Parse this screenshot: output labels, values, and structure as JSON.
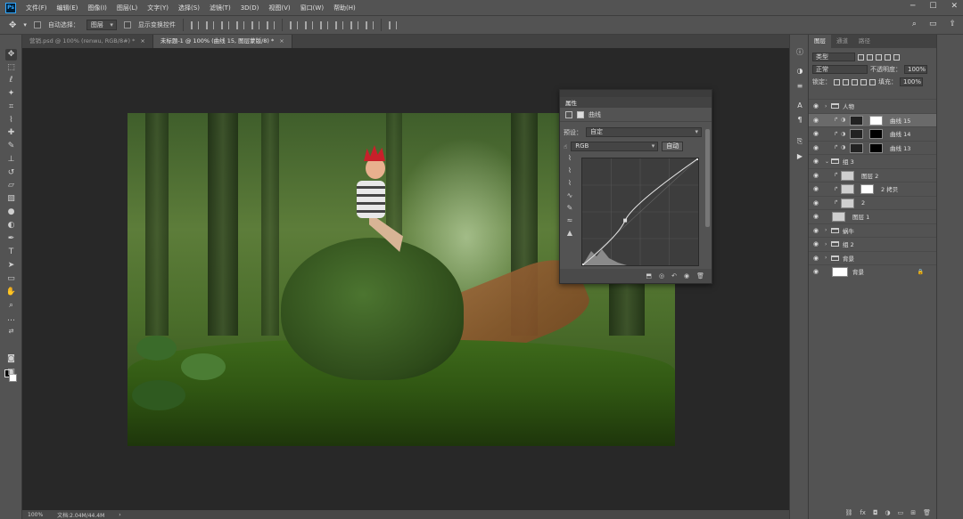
{
  "menu": [
    "文件(F)",
    "编辑(E)",
    "图像(I)",
    "图层(L)",
    "文字(Y)",
    "选择(S)",
    "滤镜(T)",
    "3D(D)",
    "视图(V)",
    "窗口(W)",
    "帮助(H)"
  ],
  "app_logo": "Ps",
  "options": {
    "auto_select_label": "自动选择：",
    "auto_select_value": "图层",
    "show_transform_label": "显示变换控件"
  },
  "tabs": [
    {
      "label": "营销.psd @ 100% (renwu, RGB/8#) *",
      "close": "×"
    },
    {
      "label": "未标题-1 @ 100% (曲线 15, 图层蒙版/8) *",
      "close": "×"
    }
  ],
  "properties": {
    "tab": "属性",
    "header_label": "曲线",
    "preset_label": "预设：",
    "preset_value": "自定",
    "channel_value": "RGB",
    "auto_button": "自动",
    "curve_points": [
      [
        0,
        0
      ],
      [
        0.37,
        0.42
      ],
      [
        1,
        1
      ]
    ]
  },
  "layers_panel": {
    "tabs": [
      "图层",
      "通道",
      "路径"
    ],
    "filter_kind": "类型",
    "blend_mode": "正常",
    "opacity_label": "不透明度：",
    "opacity_value": "100%",
    "lock_label": "锁定：",
    "fill_label": "填充：",
    "fill_value": "100%",
    "layers": [
      {
        "name": "人物",
        "kind": "group",
        "indent": 0
      },
      {
        "name": "曲线 15",
        "kind": "adjust",
        "indent": 1,
        "selected": true
      },
      {
        "name": "曲线 14",
        "kind": "adjust",
        "indent": 1
      },
      {
        "name": "曲线 13",
        "kind": "adjust",
        "indent": 1
      },
      {
        "name": "组 3",
        "kind": "group-open",
        "indent": 0
      },
      {
        "name": "图层 2",
        "kind": "pixel",
        "indent": 1
      },
      {
        "name": "2 拷贝",
        "kind": "pixel-mask",
        "indent": 1
      },
      {
        "name": "2",
        "kind": "pixel",
        "indent": 1
      },
      {
        "name": "图层 1",
        "kind": "pixel",
        "indent": 0
      },
      {
        "name": "蜗牛",
        "kind": "group",
        "indent": 0
      },
      {
        "name": "组 2",
        "kind": "group",
        "indent": 0
      },
      {
        "name": "背景",
        "kind": "group",
        "indent": 0
      },
      {
        "name": "背景",
        "kind": "background",
        "indent": 0
      }
    ],
    "footer_icons": [
      "link-icon",
      "fx-icon",
      "mask-icon",
      "adjustment-icon",
      "folder-icon",
      "new-layer-icon",
      "trash-icon"
    ]
  },
  "status": {
    "zoom": "100%",
    "doc": "文档:2.04M/44.4M"
  }
}
